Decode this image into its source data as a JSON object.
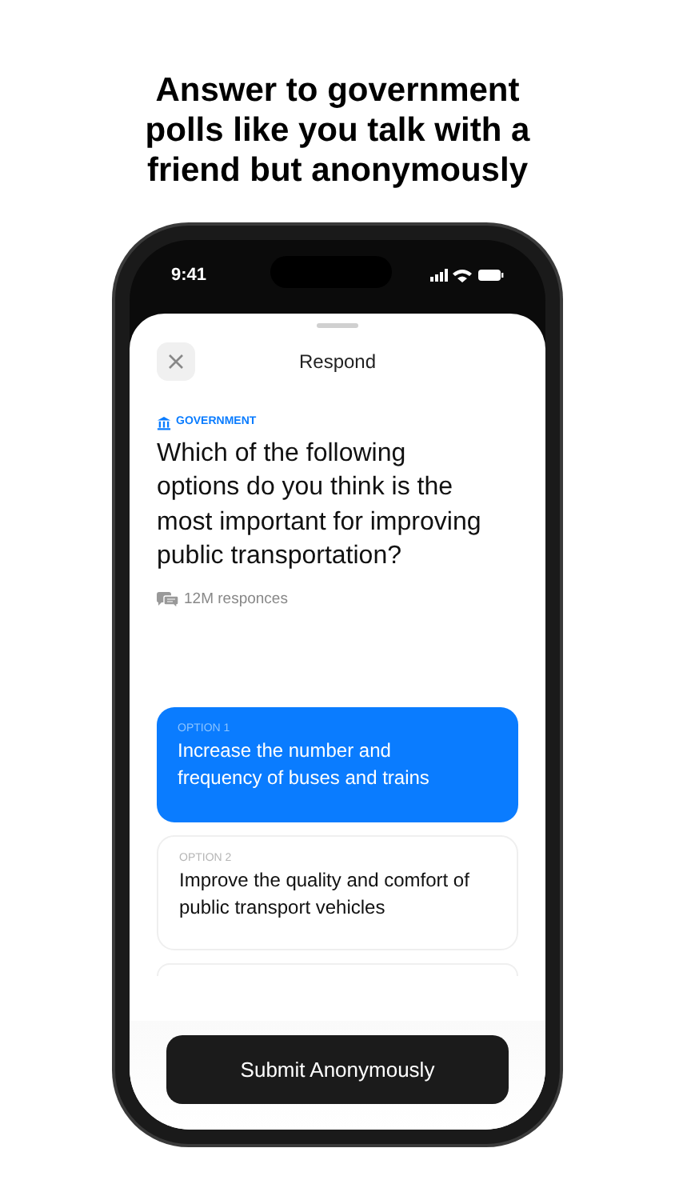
{
  "headline": "Answer to government polls like you talk with a friend but anonymously",
  "status_bar": {
    "time": "9:41"
  },
  "sheet": {
    "title": "Respond"
  },
  "question": {
    "category": "GOVERNMENT",
    "text": "Which of the following options do you think is the most important for improving public transportation?",
    "responses": "12M responces"
  },
  "options": [
    {
      "label": "OPTION 1",
      "text": "Increase the number and frequency of buses and trains",
      "selected": true
    },
    {
      "label": "OPTION 2",
      "text": "Improve the quality and comfort of public transport vehicles",
      "selected": false
    },
    {
      "selected": false
    }
  ],
  "submit_button": "Submit Anonymously"
}
